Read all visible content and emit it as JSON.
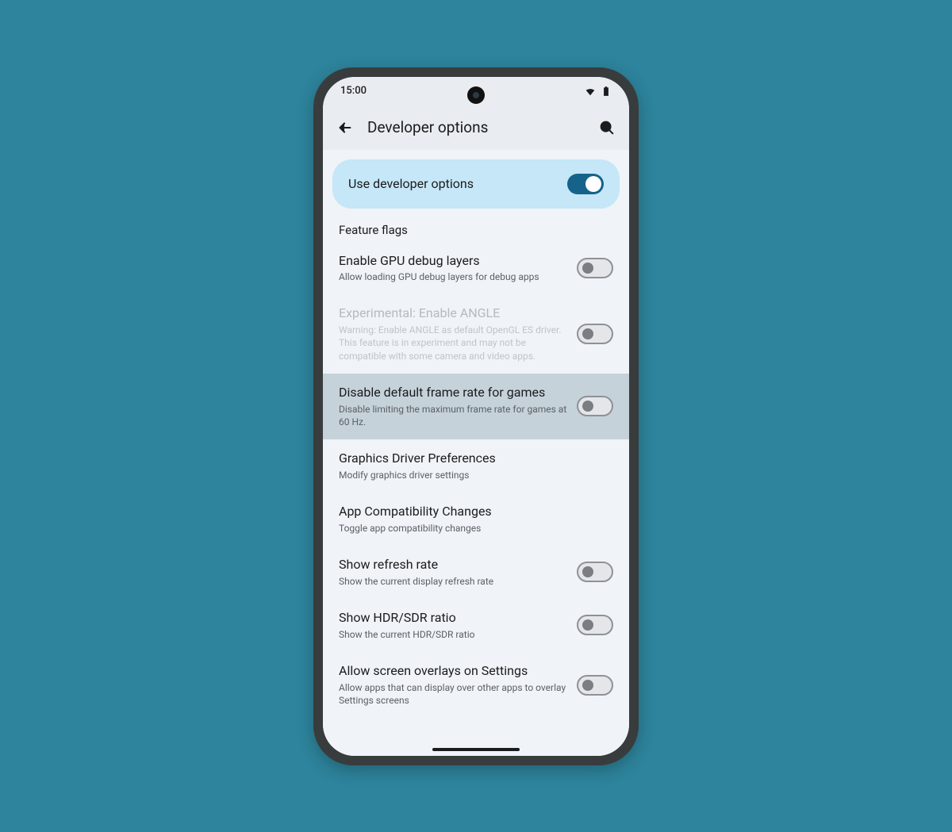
{
  "status": {
    "time": "15:00"
  },
  "header": {
    "title": "Developer options"
  },
  "master": {
    "label": "Use developer options",
    "on": true
  },
  "section": {
    "label": "Feature flags"
  },
  "rows": [
    {
      "title": "Enable GPU debug layers",
      "sub": "Allow loading GPU debug layers for debug apps",
      "toggle": true,
      "on": false,
      "disabled": false,
      "highlight": false
    },
    {
      "title": "Experimental: Enable ANGLE",
      "sub": "Warning: Enable ANGLE as default OpenGL ES driver. This feature is in experiment and may not be compatible with some camera and video apps.",
      "toggle": true,
      "on": false,
      "disabled": true,
      "highlight": false
    },
    {
      "title": "Disable default frame rate for games",
      "sub": "Disable limiting the maximum frame rate for games at 60 Hz.",
      "toggle": true,
      "on": false,
      "disabled": false,
      "highlight": true
    },
    {
      "title": "Graphics Driver Preferences",
      "sub": "Modify graphics driver settings",
      "toggle": false,
      "disabled": false,
      "highlight": false
    },
    {
      "title": "App Compatibility Changes",
      "sub": "Toggle app compatibility changes",
      "toggle": false,
      "disabled": false,
      "highlight": false
    },
    {
      "title": "Show refresh rate",
      "sub": "Show the current display refresh rate",
      "toggle": true,
      "on": false,
      "disabled": false,
      "highlight": false
    },
    {
      "title": "Show HDR/SDR ratio",
      "sub": "Show the current HDR/SDR ratio",
      "toggle": true,
      "on": false,
      "disabled": false,
      "highlight": false
    },
    {
      "title": "Allow screen overlays on Settings",
      "sub": "Allow apps that can display over other apps to overlay Settings screens",
      "toggle": true,
      "on": false,
      "disabled": false,
      "highlight": false
    }
  ]
}
